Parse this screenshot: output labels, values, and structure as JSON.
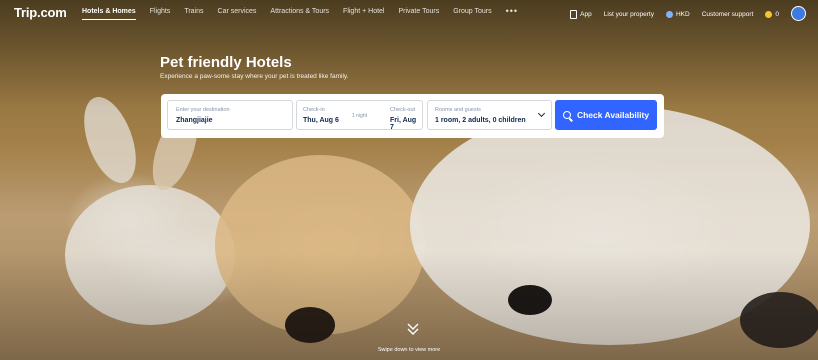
{
  "brand": {
    "logo": "Trip.com"
  },
  "nav": {
    "items": [
      {
        "label": "Hotels & Homes",
        "active": true
      },
      {
        "label": "Flights"
      },
      {
        "label": "Trains"
      },
      {
        "label": "Car services"
      },
      {
        "label": "Attractions & Tours"
      },
      {
        "label": "Flight + Hotel"
      },
      {
        "label": "Private Tours"
      },
      {
        "label": "Group Tours"
      }
    ],
    "more": "•••",
    "right": {
      "app": "App",
      "list_property": "List your property",
      "currency": "HKD",
      "support": "Customer support",
      "coins": "0"
    }
  },
  "hero": {
    "title": "Pet friendly Hotels",
    "subtitle": "Experience a paw-some stay where your pet is treated like family."
  },
  "search": {
    "destination": {
      "label": "Enter your destination",
      "value": "Zhangjiajie"
    },
    "checkin": {
      "label": "Check-in",
      "value": "Thu, Aug 6"
    },
    "nights": "1 night",
    "checkout": {
      "label": "Check-out",
      "value": "Fri, Aug 7"
    },
    "guests": {
      "label": "Rooms and guests",
      "value": "1 room, 2 adults, 0 children"
    },
    "button": "Check Availability"
  },
  "scroll": {
    "text": "Swipe down to view more"
  },
  "colors": {
    "accent": "#3264ff",
    "text_dark": "#0f294d"
  }
}
